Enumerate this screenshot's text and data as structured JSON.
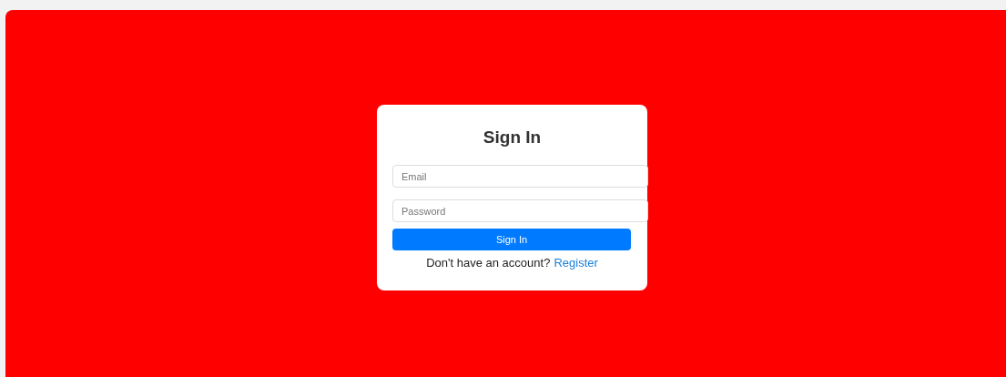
{
  "form": {
    "title": "Sign In",
    "fields": [
      {
        "placeholder": "Email"
      },
      {
        "placeholder": "Password"
      }
    ],
    "submit": "Sign In",
    "footer": {
      "text": "Don't have an account?",
      "link": "Register"
    }
  }
}
